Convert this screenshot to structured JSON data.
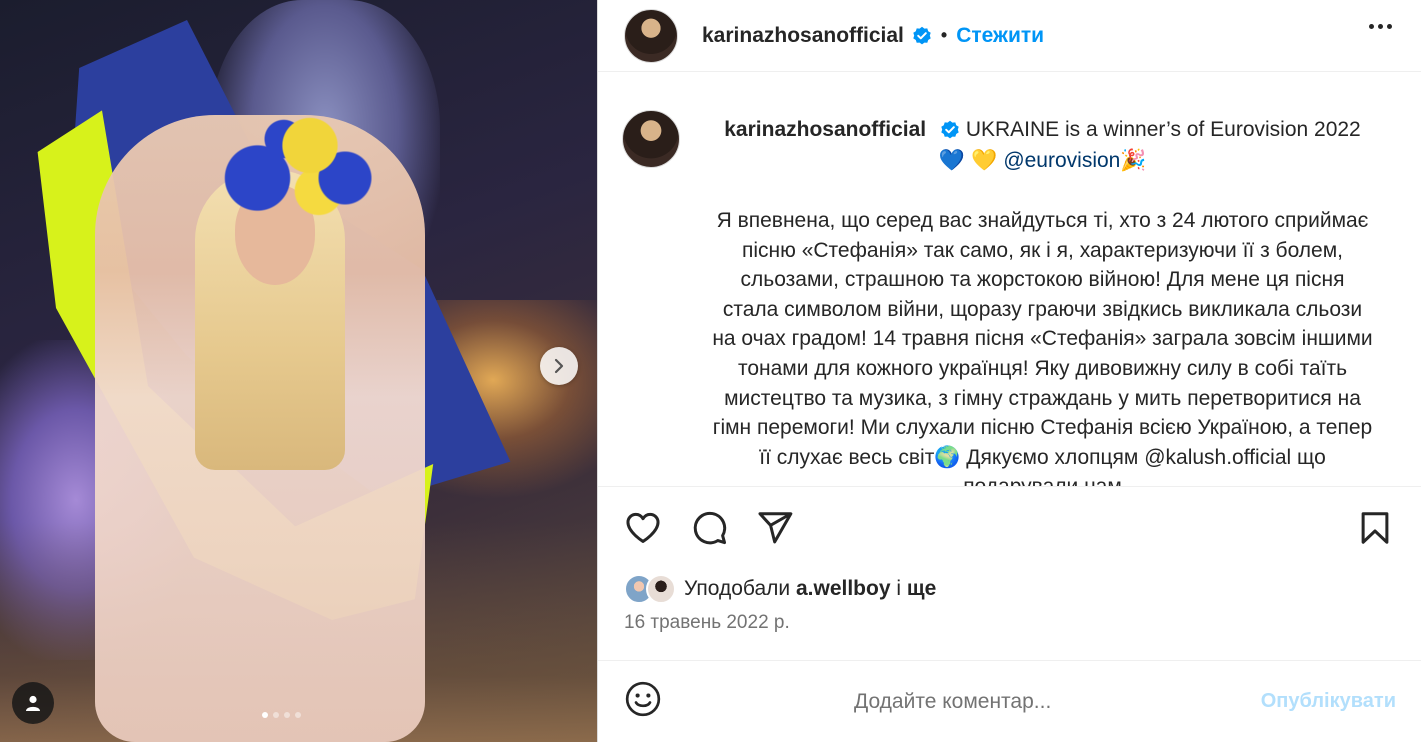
{
  "post": {
    "username": "karinazhosanofficial",
    "follow_label": "Стежити",
    "separator": "•"
  },
  "media": {
    "carousel_total": 4,
    "carousel_active": 1
  },
  "caption": {
    "username": "karinazhosanofficial",
    "headline": "UKRAINE is a winner’s of Eurovision 2022",
    "hearts": "💙 💛",
    "mention": "@eurovision",
    "party_emoji": "🎉",
    "body": "Я впевнена, що серед вас знайдуться ті, хто з 24 лютого сприймає пісню «Стефанія» так само, як і я, характеризуючи її з болем, сльозами, страшною та жорстокою війною! Для мене ця пісня стала символом війни, щоразу граючи звідкись викликала сльози на очах градом! 14 травня пісня «Стефанія» заграла зовсім іншими тонами для кожного українця! Яку дивовижну силу в собі таїть мистецтво та музика, з гімну страждань у мить перетворитися на гімн перемоги! Ми слухали пісню Стефанія всією Україною, а тепер її слухає весь світ🌍 Дякуємо хлопцям @kalush.official що подарували нам"
  },
  "likes": {
    "prefix": "Уподобали",
    "user": "a.wellboy",
    "and": "і",
    "more": "ще"
  },
  "date": "16 травень 2022 р.",
  "comment": {
    "placeholder": "Додайте коментар...",
    "publish_label": "Опублікувати"
  },
  "colors": {
    "accent": "#0095f6",
    "verified": "#0095f6",
    "publish_disabled": "#b2dffc",
    "secondary_text": "#737373"
  },
  "icons": [
    "verified-badge-icon",
    "more-options-icon",
    "chevron-right-icon",
    "user-tag-icon",
    "heart-icon",
    "comment-icon",
    "share-icon",
    "bookmark-icon",
    "emoji-icon"
  ]
}
